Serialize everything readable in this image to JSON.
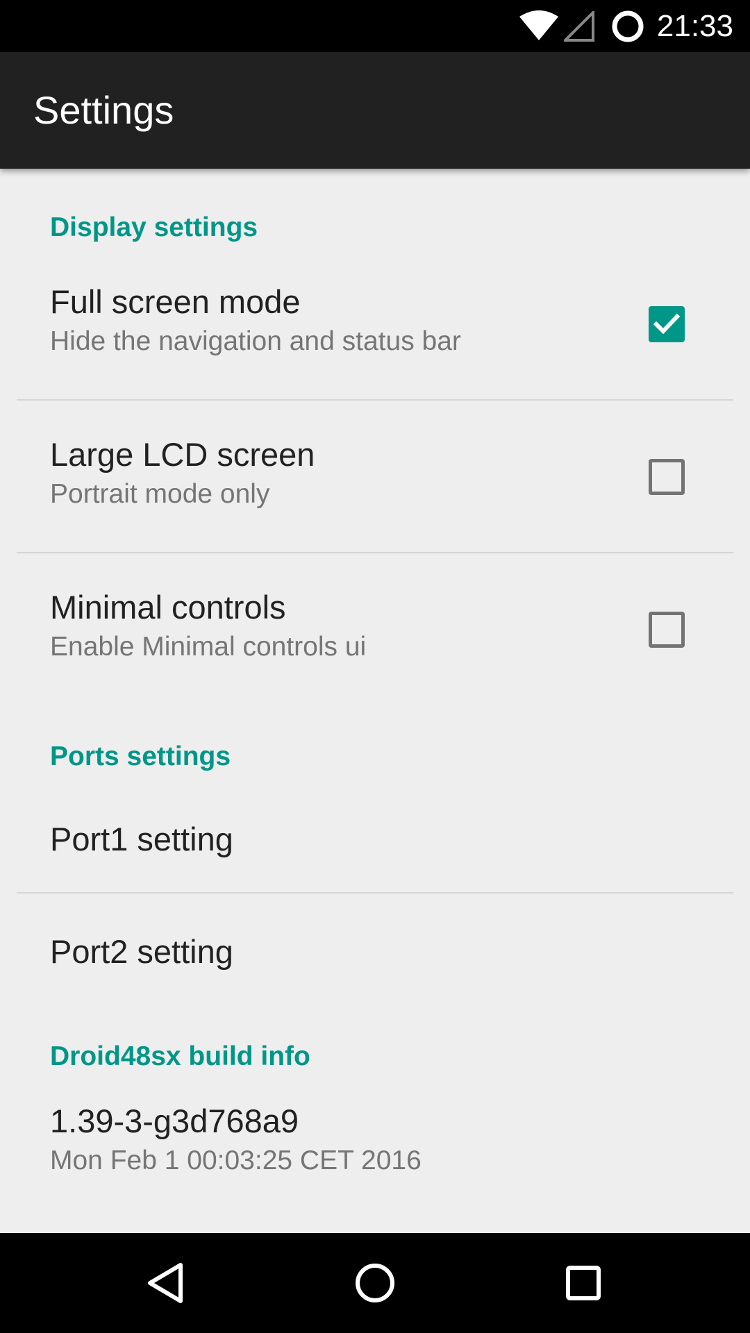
{
  "status_bar": {
    "time": "21:33",
    "icons": [
      "wifi-icon",
      "cell-signal-icon",
      "battery-icon"
    ]
  },
  "app_bar": {
    "title": "Settings"
  },
  "sections": {
    "display": {
      "header": "Display settings",
      "full_screen": {
        "title": "Full screen mode",
        "summary": "Hide the navigation and status bar",
        "checked": true
      },
      "large_lcd": {
        "title": "Large LCD screen",
        "summary": "Portrait mode only",
        "checked": false
      },
      "minimal_controls": {
        "title": "Minimal controls",
        "summary": "Enable Minimal controls ui",
        "checked": false
      }
    },
    "ports": {
      "header": "Ports settings",
      "port1": {
        "title": "Port1 setting"
      },
      "port2": {
        "title": "Port2 setting"
      }
    },
    "build": {
      "header": "Droid48sx build info",
      "version": "1.39-3-g3d768a9",
      "date": "Mon Feb 1 00:03:25 CET 2016"
    }
  },
  "nav_bar": {
    "icons": [
      "back-icon",
      "home-icon",
      "recents-icon"
    ]
  },
  "colors": {
    "accent": "#009688",
    "app_bar": "#212121",
    "background": "#eeeeee"
  }
}
